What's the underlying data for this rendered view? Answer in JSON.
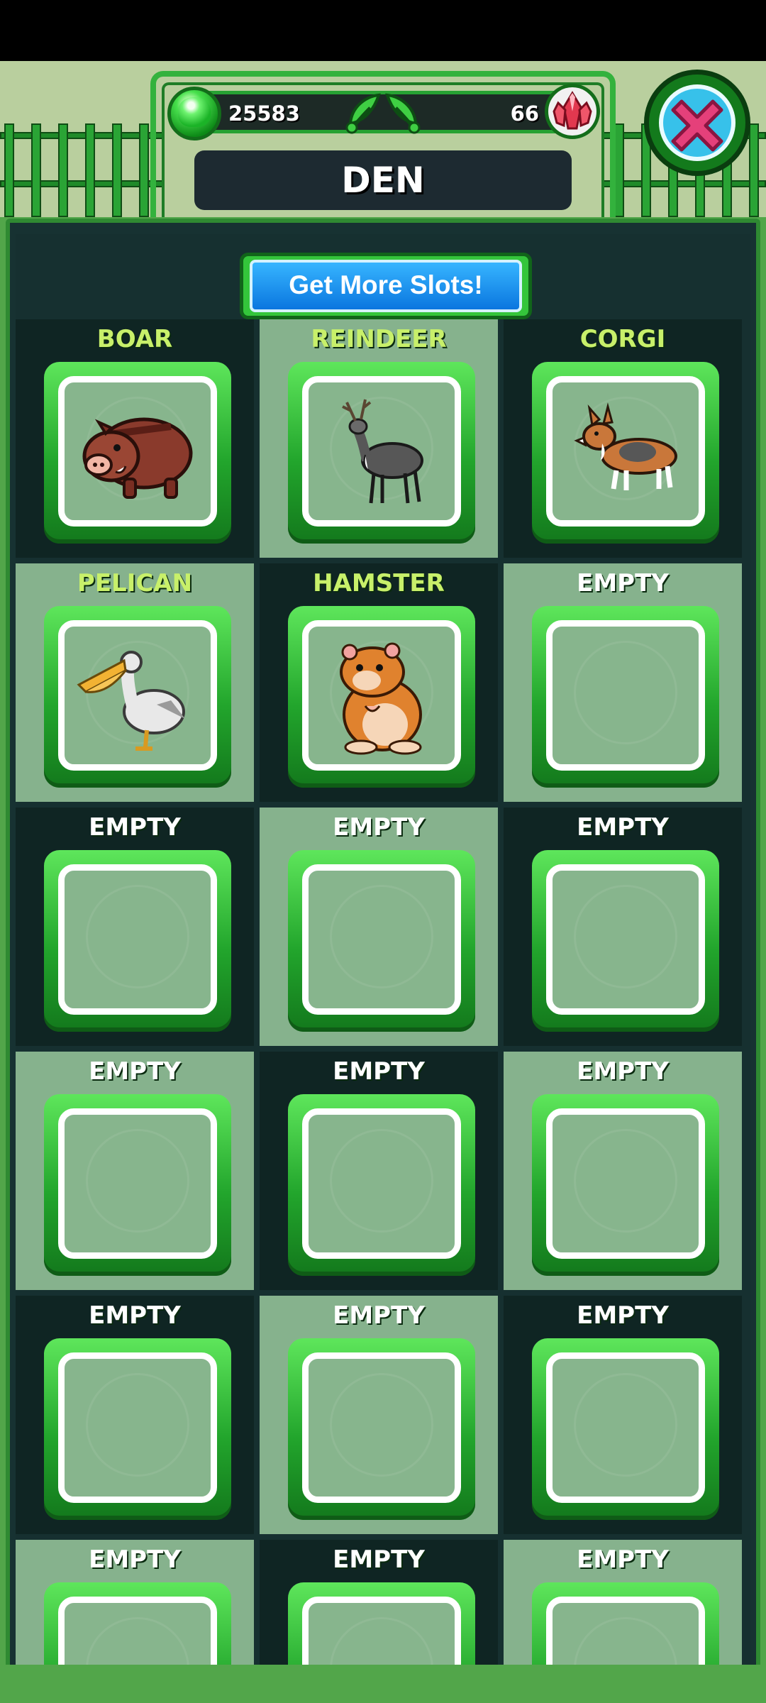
{
  "currency": {
    "gems": "25583",
    "crystals": "66"
  },
  "title": "DEN",
  "more_slots_label": "Get More Slots!",
  "slots": [
    {
      "name": "BOAR",
      "animal": "boar"
    },
    {
      "name": "REINDEER",
      "animal": "reindeer"
    },
    {
      "name": "CORGI",
      "animal": "corgi"
    },
    {
      "name": "PELICAN",
      "animal": "pelican"
    },
    {
      "name": "HAMSTER",
      "animal": "hamster"
    },
    {
      "name": "EMPTY",
      "animal": ""
    },
    {
      "name": "EMPTY",
      "animal": ""
    },
    {
      "name": "EMPTY",
      "animal": ""
    },
    {
      "name": "EMPTY",
      "animal": ""
    },
    {
      "name": "EMPTY",
      "animal": ""
    },
    {
      "name": "EMPTY",
      "animal": ""
    },
    {
      "name": "EMPTY",
      "animal": ""
    },
    {
      "name": "EMPTY",
      "animal": ""
    },
    {
      "name": "EMPTY",
      "animal": ""
    },
    {
      "name": "EMPTY",
      "animal": ""
    },
    {
      "name": "EMPTY",
      "animal": ""
    },
    {
      "name": "EMPTY",
      "animal": ""
    },
    {
      "name": "EMPTY",
      "animal": ""
    }
  ],
  "icons": {
    "gem": "green-gem-icon",
    "crystal": "red-crystal-icon",
    "close": "close-x-icon"
  },
  "colors": {
    "accent_green": "#33b23d",
    "button_blue": "#1e90f0",
    "close_pink": "#e5407a",
    "filled_name": "#c8f06a"
  }
}
